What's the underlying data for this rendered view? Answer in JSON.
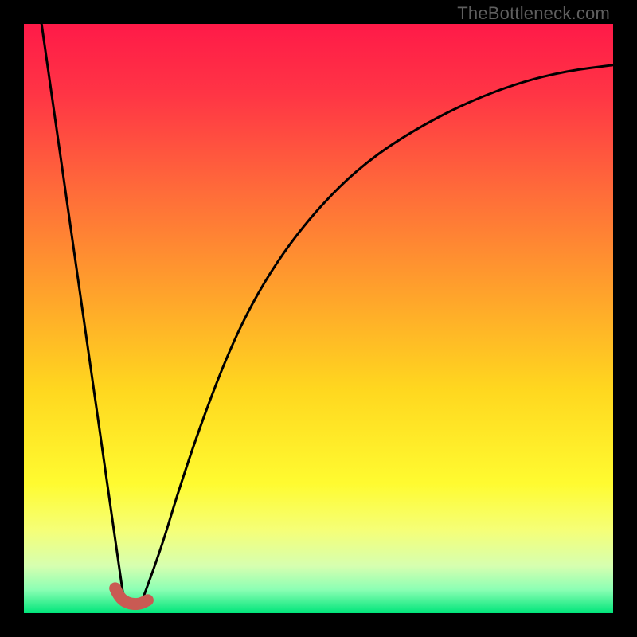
{
  "watermark": "TheBottleneck.com",
  "gradient": {
    "stops": [
      {
        "offset": 0.0,
        "color": "#ff1a48"
      },
      {
        "offset": 0.12,
        "color": "#ff3545"
      },
      {
        "offset": 0.28,
        "color": "#ff6a3a"
      },
      {
        "offset": 0.45,
        "color": "#ffa02c"
      },
      {
        "offset": 0.62,
        "color": "#ffd71f"
      },
      {
        "offset": 0.78,
        "color": "#fffb30"
      },
      {
        "offset": 0.86,
        "color": "#f5ff78"
      },
      {
        "offset": 0.92,
        "color": "#d6ffb0"
      },
      {
        "offset": 0.96,
        "color": "#8cffb4"
      },
      {
        "offset": 1.0,
        "color": "#00e57a"
      }
    ]
  },
  "chart_data": {
    "type": "line",
    "title": "",
    "xlabel": "",
    "ylabel": "",
    "xlim": [
      0,
      100
    ],
    "ylim": [
      0,
      100
    ],
    "series": [
      {
        "name": "left-line",
        "x": [
          3,
          17
        ],
        "y": [
          100,
          2
        ]
      },
      {
        "name": "right-curve",
        "x": [
          20,
          23,
          26,
          30,
          35,
          40,
          46,
          53,
          60,
          68,
          76,
          84,
          92,
          100
        ],
        "y": [
          2,
          10,
          20,
          32,
          45,
          55,
          64,
          72,
          78,
          83,
          87,
          90,
          92,
          93
        ]
      }
    ],
    "marker": {
      "name": "elbow-marker",
      "color": "#c95a53",
      "points_xy": [
        [
          15.5,
          4.2
        ],
        [
          16.2,
          2.6
        ],
        [
          17.8,
          1.6
        ],
        [
          19.6,
          1.5
        ],
        [
          21.0,
          2.2
        ]
      ],
      "stroke_width_px": 15
    }
  }
}
